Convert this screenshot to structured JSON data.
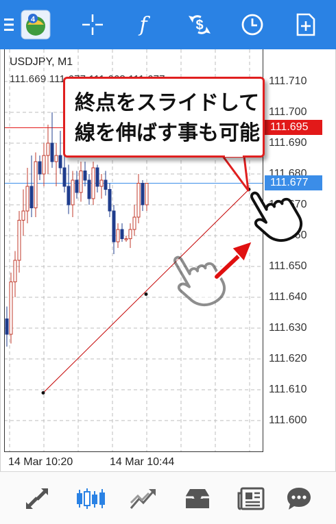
{
  "toolbar": {
    "items": [
      "menu-icon",
      "app-logo",
      "crosshair-icon",
      "indicator-icon",
      "objects-icon",
      "timeframe-icon",
      "add-icon"
    ],
    "indicator_label": "f",
    "logo_badge": "4"
  },
  "chart": {
    "symbol": "USDJPY, M1",
    "ohlc": "111.669 111.677 111.668 111.677",
    "price_axis": [
      "111.710",
      "111.700",
      "111.690",
      "111.680",
      "111.670",
      "111.660",
      "111.650",
      "111.640",
      "111.630",
      "111.620",
      "111.610",
      "111.600"
    ],
    "bid_price": "111.695",
    "ask_price": "111.677",
    "time_axis": [
      "14 Mar 10:20",
      "14 Mar 10:44"
    ],
    "colors": {
      "bull": "#c0392b",
      "bear": "#1f3c8c",
      "bid_line": "#e21919",
      "ask_line": "#3b8de8",
      "trendline": "#c40000"
    }
  },
  "callout": {
    "line1": "終点をスライドして",
    "line2": "線を伸ばす事も可能"
  },
  "chart_data": {
    "type": "candlestick",
    "title": "USDJPY, M1",
    "ylim": [
      111.592,
      111.717
    ],
    "candles_open_high_low_close": [
      [
        111.633,
        111.637,
        111.624,
        111.628
      ],
      [
        111.628,
        111.648,
        111.625,
        111.645
      ],
      [
        111.645,
        111.655,
        111.64,
        111.652
      ],
      [
        111.652,
        111.668,
        111.648,
        111.665
      ],
      [
        111.665,
        111.675,
        111.66,
        111.668
      ],
      [
        111.668,
        111.682,
        111.664,
        111.676
      ],
      [
        111.676,
        111.686,
        111.666,
        111.669
      ],
      [
        111.669,
        111.687,
        111.666,
        111.684
      ],
      [
        111.684,
        111.686,
        111.678,
        111.68
      ],
      [
        111.68,
        111.69,
        111.676,
        111.686
      ],
      [
        111.686,
        111.696,
        111.68,
        111.69
      ],
      [
        111.69,
        111.7,
        111.682,
        111.684
      ],
      [
        111.684,
        111.69,
        111.676,
        111.686
      ],
      [
        111.686,
        111.694,
        111.68,
        111.682
      ],
      [
        111.682,
        111.686,
        111.674,
        111.676
      ],
      [
        111.676,
        111.683,
        111.667,
        111.67
      ],
      [
        111.67,
        111.681,
        111.666,
        111.678
      ],
      [
        111.678,
        111.681,
        111.672,
        111.674
      ],
      [
        111.674,
        111.684,
        111.671,
        111.681
      ],
      [
        111.681,
        111.684,
        111.676,
        111.678
      ],
      [
        111.678,
        111.68,
        111.67,
        111.672
      ],
      [
        111.672,
        111.684,
        111.67,
        111.682
      ],
      [
        111.682,
        111.683,
        111.674,
        111.676
      ],
      [
        111.676,
        111.68,
        111.672,
        111.678
      ],
      [
        111.678,
        111.681,
        111.673,
        111.675
      ],
      [
        111.675,
        111.677,
        111.666,
        111.668
      ],
      [
        111.668,
        111.67,
        111.654,
        111.658
      ],
      [
        111.658,
        111.664,
        111.656,
        111.662
      ],
      [
        111.662,
        111.664,
        111.658,
        111.659
      ],
      [
        111.659,
        111.66,
        111.658,
        111.659
      ],
      [
        111.659,
        111.664,
        111.656,
        111.662
      ],
      [
        111.662,
        111.67,
        111.66,
        111.666
      ],
      [
        111.666,
        111.68,
        111.664,
        111.677
      ],
      [
        111.677,
        111.678,
        111.668,
        111.67
      ],
      [
        111.67,
        111.677,
        111.668,
        111.677
      ]
    ],
    "trendline": {
      "start": [
        111.609,
        "10:20"
      ],
      "mid": [
        111.641,
        ""
      ],
      "end": [
        111.675,
        ""
      ]
    }
  },
  "bottom_nav": {
    "items": [
      "quotes-icon",
      "chart-icon",
      "trade-icon",
      "history-icon",
      "news-icon",
      "chat-icon"
    ],
    "active": "chart-icon"
  }
}
